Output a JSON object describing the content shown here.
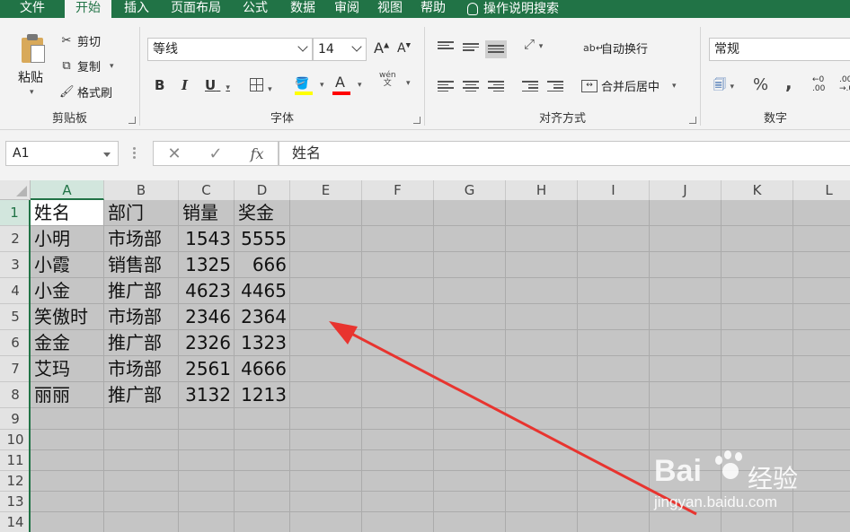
{
  "ribbon_tabs": [
    {
      "label": "文件",
      "active": false
    },
    {
      "label": "开始",
      "active": true
    },
    {
      "label": "插入",
      "active": false
    },
    {
      "label": "页面布局",
      "active": false
    },
    {
      "label": "公式",
      "active": false
    },
    {
      "label": "数据",
      "active": false
    },
    {
      "label": "审阅",
      "active": false
    },
    {
      "label": "视图",
      "active": false
    },
    {
      "label": "帮助",
      "active": false
    }
  ],
  "tell_me": "操作说明搜索",
  "clipboard": {
    "paste": "粘贴",
    "cut": "剪切",
    "copy": "复制",
    "format_painter": "格式刷",
    "label": "剪贴板"
  },
  "font": {
    "name": "等线",
    "size": "14",
    "grow": "A",
    "shrink": "A",
    "bold": "B",
    "italic": "I",
    "underline": "U",
    "font_color": "A",
    "phonetic": "wén",
    "label": "字体"
  },
  "alignment": {
    "wrap_text": "自动换行",
    "merge_center": "合并后居中",
    "label": "对齐方式"
  },
  "number": {
    "format": "常规",
    "percent": "%",
    "comma": ",",
    "label": "数字"
  },
  "formula_bar": {
    "name_box": "A1",
    "cancel": "✕",
    "enter": "✓",
    "fx": "fx",
    "content": "姓名"
  },
  "sheet": {
    "columns": [
      "A",
      "B",
      "C",
      "D",
      "E",
      "F",
      "G",
      "H",
      "I",
      "J",
      "K",
      "L"
    ],
    "rows": [
      "1",
      "2",
      "3",
      "4",
      "5",
      "6",
      "7",
      "8",
      "9",
      "10",
      "11",
      "12",
      "13",
      "14"
    ],
    "active_cell": "A1",
    "data": [
      [
        "姓名",
        "部门",
        "销量",
        "奖金"
      ],
      [
        "小明",
        "市场部",
        "1543",
        "5555"
      ],
      [
        "小霞",
        "销售部",
        "1325",
        "666"
      ],
      [
        "小金",
        "推广部",
        "4623",
        "4465"
      ],
      [
        "笑傲时",
        "市场部",
        "2346",
        "2364"
      ],
      [
        "金金",
        "推广部",
        "2326",
        "1323"
      ],
      [
        "艾玛",
        "市场部",
        "2561",
        "4666"
      ],
      [
        "丽丽",
        "推广部",
        "3132",
        "1213"
      ]
    ]
  },
  "colors": {
    "excel_green": "#217346",
    "selection_gray": "#c5c5c5",
    "arrow_red": "#e8342f"
  },
  "watermark": {
    "brand_left": "Bai",
    "brand_right": "经验",
    "url": "jingyan.baidu.com"
  }
}
